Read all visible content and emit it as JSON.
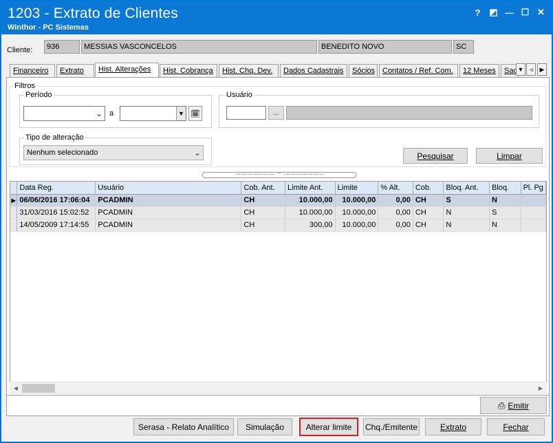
{
  "window": {
    "title": "1203 - Extrato de Clientes",
    "subtitle": "Winthor - PC Sistemas",
    "controls": [
      "?",
      "◩",
      "—",
      "☐",
      "✕"
    ]
  },
  "client": {
    "label": "Cliente:",
    "code": "936",
    "name": "MESSIAS VASCONCELOS",
    "city": "BENEDITO NOVO",
    "state": "SC"
  },
  "tabs": [
    {
      "label": "Financeiro"
    },
    {
      "label": "Extrato"
    },
    {
      "label": "Hist. Alterações",
      "active": true
    },
    {
      "label": "Hist. Cobrança"
    },
    {
      "label": "Hist. Chq. Dev."
    },
    {
      "label": "Dados Cadastrais"
    },
    {
      "label": "Sócios"
    },
    {
      "label": "Contatos / Ref. Com."
    },
    {
      "label": "12 Meses"
    },
    {
      "label": "Sac"
    }
  ],
  "filters": {
    "title": "Filtros",
    "period_label": "Período",
    "period_separator": "a",
    "period_start": "",
    "period_end": "",
    "user_label": "Usuário",
    "user_code": "",
    "user_lookup": "...",
    "user_name": "",
    "change_type_label": "Tipo de alteração",
    "change_type_value": "Nenhum selecionado",
    "search_button": "Pesquisar",
    "clear_button": "Limpar"
  },
  "grid": {
    "columns": [
      "Data Reg.",
      "Usuário",
      "Cob. Ant.",
      "Limite Ant.",
      "Limite",
      "% Alt.",
      "Cob.",
      "Bloq. Ant.",
      "Bloq.",
      "Pl. Pg"
    ],
    "rows": [
      [
        "06/06/2016 17:06:04",
        "PCADMIN",
        "CH",
        "10.000,00",
        "10.000,00",
        "0,00",
        "CH",
        "S",
        "N",
        ""
      ],
      [
        "31/03/2016 15:02:52",
        "PCADMIN",
        "CH",
        "10.000,00",
        "10.000,00",
        "0,00",
        "CH",
        "N",
        "S",
        ""
      ],
      [
        "14/05/2009 17:14:55",
        "PCADMIN",
        "CH",
        "300,00",
        "10.000,00",
        "0,00",
        "CH",
        "N",
        "N",
        ""
      ]
    ]
  },
  "buttons": {
    "print": "Emitir",
    "serasa": "Serasa - Relato Analítico",
    "simulation": "Simulação",
    "change_limit": "Alterar limite",
    "check_issuer": "Chq./Emitente",
    "statement": "Extrato",
    "close": "Fechar"
  },
  "colors": {
    "titlebar": "#0a78d4",
    "highlight_border": "#d0202a",
    "selected_row": "#ccd3e3"
  }
}
